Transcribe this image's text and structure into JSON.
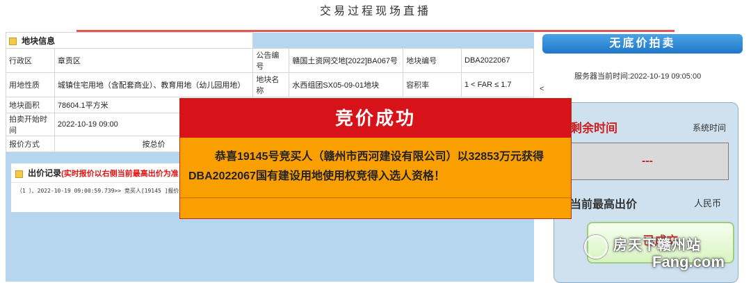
{
  "page": {
    "title": "交易过程现场直播"
  },
  "land_info": {
    "section_title": "地块信息",
    "rows": [
      {
        "l1": "行政区",
        "v1": "章贡区",
        "l2": "公告编号",
        "v2": "赣国土资网交地[2022]BA067号",
        "l3": "地块编号",
        "v3": "DBA2022067"
      },
      {
        "l1": "用地性质",
        "v1": "城镇住宅用地（含配套商业）、教育用地（幼儿园用地）",
        "l2": "地块名称",
        "v2": "水西组团SX05-09-01地块",
        "l3": "容积率",
        "v3": "1 < FAR ≤ 1.7"
      },
      {
        "l1": "地块面积",
        "v1": "78604.1平方米"
      },
      {
        "l1": "拍卖开始时间",
        "v1": "2022-10-19 09:00"
      },
      {
        "l1": "报价方式",
        "v1": "按总价"
      }
    ]
  },
  "bid_records": {
    "title": "出价记录",
    "note": "(实时报价以右侧当前最高出价为准",
    "entry": "（1 ）、2022-10-19 09:00:59.739>> 竞买人[19145 ]报价"
  },
  "auction": {
    "title": "无底价拍卖",
    "server_time": "服务器当前时间:2022-10-19 09:05:00",
    "lt": "<",
    "remaining_label": "剩余时间",
    "system_time": "系统时间",
    "countdown": "---",
    "highest_label": "当前最高出价",
    "currency": "人民币",
    "sold_label": "已成交"
  },
  "modal": {
    "title": "竞价成功",
    "message": "恭喜19145号竞买人（赣州市西河建设有限公司）以32853万元获得DBA2022067国有建设用地使用权竞得入选人资格！"
  },
  "watermark": {
    "text": "房天下赣州站",
    "logo": "Fang.com"
  }
}
